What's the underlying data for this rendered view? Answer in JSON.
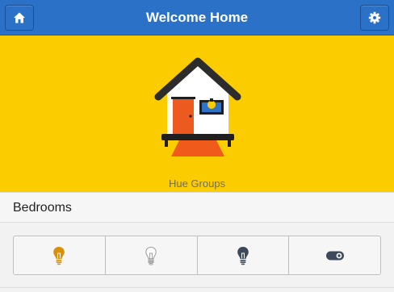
{
  "header": {
    "title": "Welcome Home",
    "home_icon": "home-icon",
    "settings_icon": "gear-icon"
  },
  "banner": {
    "caption": "Hue Groups",
    "background": "#fbcd00"
  },
  "section": {
    "title": "Bedrooms"
  },
  "controls": [
    {
      "name": "all-lights-on-button",
      "icon": "bulb-on-icon",
      "color": "#d8900d"
    },
    {
      "name": "all-lights-off-button",
      "icon": "bulb-outline-icon",
      "color": "#9a9a9a"
    },
    {
      "name": "lights-dim-button",
      "icon": "bulb-dark-icon",
      "color": "#3d4a59"
    },
    {
      "name": "group-toggle",
      "icon": "toggle-icon",
      "color": "#3d4a59"
    }
  ],
  "colors": {
    "accent": "#2b71c8"
  }
}
